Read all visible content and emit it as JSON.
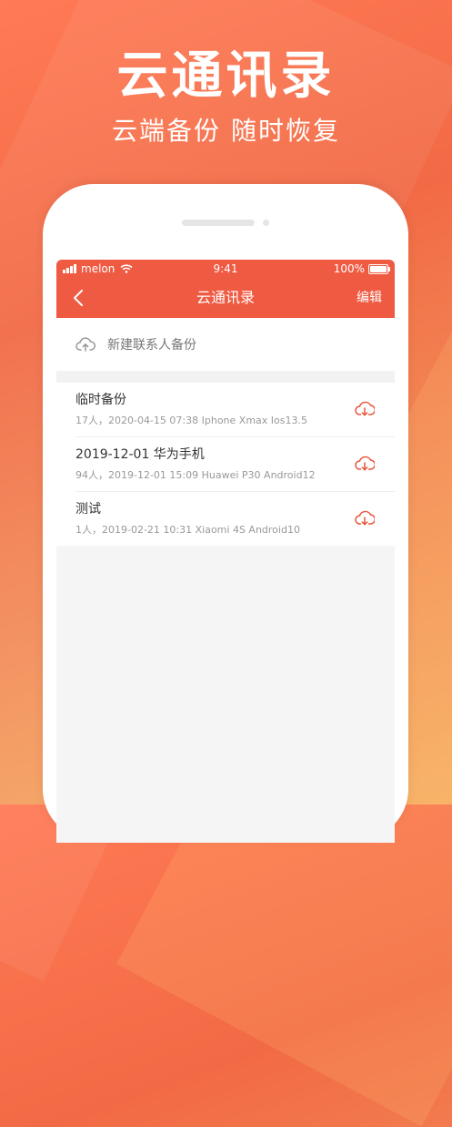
{
  "hero": {
    "title": "云通讯录",
    "subtitle": "云端备份 随时恢复"
  },
  "status_bar": {
    "carrier": "melon",
    "time": "9:41",
    "battery": "100%"
  },
  "navbar": {
    "title": "云通讯录",
    "edit_label": "编辑",
    "back_icon": "chevron-left-icon"
  },
  "new_backup": {
    "label": "新建联系人备份",
    "icon": "cloud-upload-icon"
  },
  "backups": [
    {
      "title": "临时备份",
      "subtitle": "17人，2020-04-15 07:38 Iphone Xmax Ios13.5",
      "icon": "cloud-download-icon"
    },
    {
      "title": "2019-12-01 华为手机",
      "subtitle": "94人，2019-12-01 15:09 Huawei P30 Android12",
      "icon": "cloud-download-icon"
    },
    {
      "title": "测试",
      "subtitle": "1人，2019-02-21 10:31 Xiaomi 4S Android10",
      "icon": "cloud-download-icon"
    }
  ],
  "colors": {
    "accent": "#ef5a42",
    "download_icon": "#e8543c",
    "upload_icon": "#999999"
  }
}
